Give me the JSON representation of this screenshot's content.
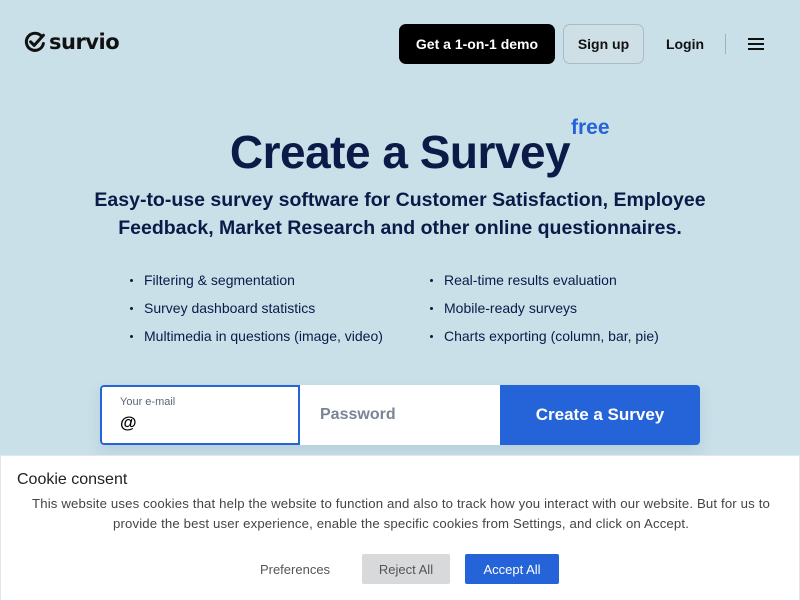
{
  "colors": {
    "background": "#c9e0e9",
    "navy_text": "#0b1a47",
    "accent_blue": "#2563d9",
    "demo_button": "#000000",
    "cookie_reject": "#d8d9db"
  },
  "header": {
    "logo_text": "survio",
    "logo_icon": "checkmark-circle-icon",
    "demo_label": "Get a 1-on-1 demo",
    "signup_label": "Sign up",
    "login_label": "Login",
    "menu_icon": "hamburger-menu-icon"
  },
  "hero": {
    "title": "Create a Survey",
    "badge": "free",
    "subtitle": "Easy-to-use survey software for Customer Satisfaction, Employee Feedback, Market Research and other online questionnaires.",
    "features_left": [
      "Filtering & segmentation",
      "Survey dashboard statistics",
      "Multimedia in questions (image, video)"
    ],
    "features_right": [
      "Real-time results evaluation",
      "Mobile-ready surveys",
      "Charts exporting (column, bar, pie)"
    ]
  },
  "form": {
    "email_label": "Your e-mail",
    "email_value": "@",
    "password_placeholder": "Password",
    "submit_label": "Create a Survey"
  },
  "cookie": {
    "title": "Cookie consent",
    "text": "This website uses cookies that help the website to function and also to track how you interact with our website. But for us to provide the best user experience, enable the specific cookies from Settings, and click on Accept.",
    "preferences_label": "Preferences",
    "reject_label": "Reject All",
    "accept_label": "Accept All"
  }
}
